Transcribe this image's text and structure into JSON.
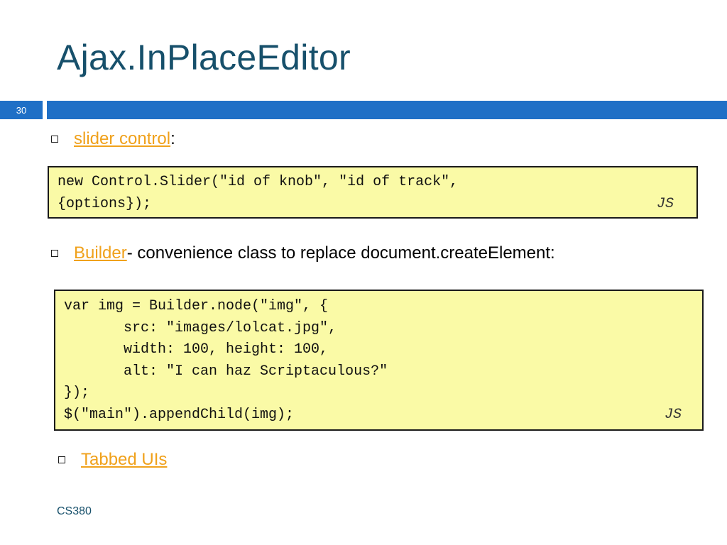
{
  "slide": {
    "title": "Ajax.InPlaceEditor",
    "number": "30",
    "footer": "CS380"
  },
  "bullets": [
    {
      "link": "slider control",
      "text": ":"
    },
    {
      "link": "Builder",
      "text": " - convenience class to replace document.createElement:"
    },
    {
      "link": "Tabbed UIs",
      "text": ""
    }
  ],
  "code_blocks": [
    {
      "lines": [
        "new Control.Slider(\"id of knob\", \"id of track\",",
        "{options});"
      ],
      "tag": "JS"
    },
    {
      "lines": [
        "var img = Builder.node(\"img\", {",
        "       src: \"images/lolcat.jpg\",",
        "       width: 100, height: 100,",
        "       alt: \"I can haz Scriptaculous?\"",
        "});",
        "$(\"main\").appendChild(img);"
      ],
      "tag": "JS"
    }
  ],
  "colors": {
    "title": "#17506b",
    "accent_bar": "#1f6fc6",
    "link": "#f0a11b",
    "code_bg": "#fafaa6"
  }
}
